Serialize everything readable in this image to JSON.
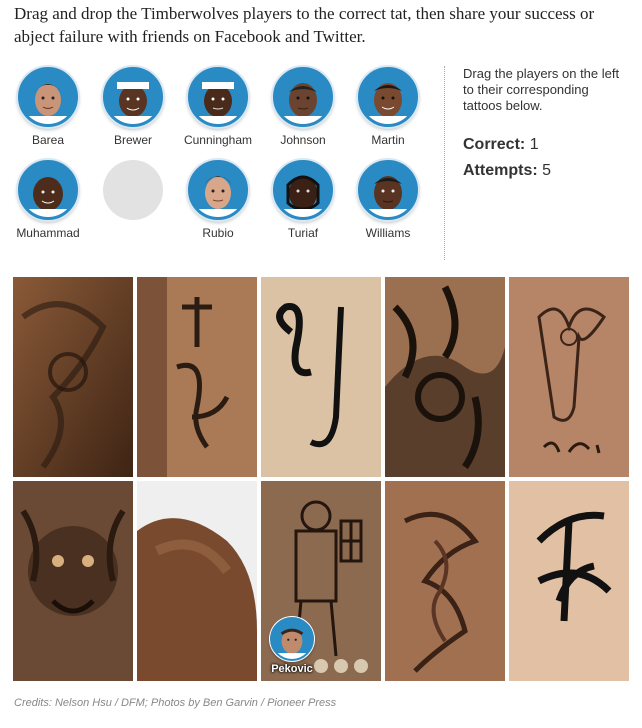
{
  "intro": "Drag and drop the Timberwolves players to the correct tat, then share your success or abject failure with friends on Facebook and Twitter.",
  "players_row1": [
    {
      "name": "Barea"
    },
    {
      "name": "Brewer"
    },
    {
      "name": "Cunningham"
    },
    {
      "name": "Johnson"
    },
    {
      "name": "Martin"
    }
  ],
  "players_row2": [
    {
      "name": "Muhammad"
    },
    {
      "name": ""
    },
    {
      "name": "Rubio"
    },
    {
      "name": "Turiaf"
    },
    {
      "name": "Williams"
    }
  ],
  "instructions": "Drag the players on the left to their corresponding tattoos below.",
  "score": {
    "correct_label": "Correct:",
    "correct_value": "1",
    "attempts_label": "Attempts:",
    "attempts_value": "5"
  },
  "placed_player": "Pekovic",
  "credits": "Credits: Nelson Hsu / DFM; Photos by Ben Garvin / Pioneer Press",
  "colors": {
    "accent": "#2a8ac4",
    "empty_slot": "#e2e2e2"
  }
}
